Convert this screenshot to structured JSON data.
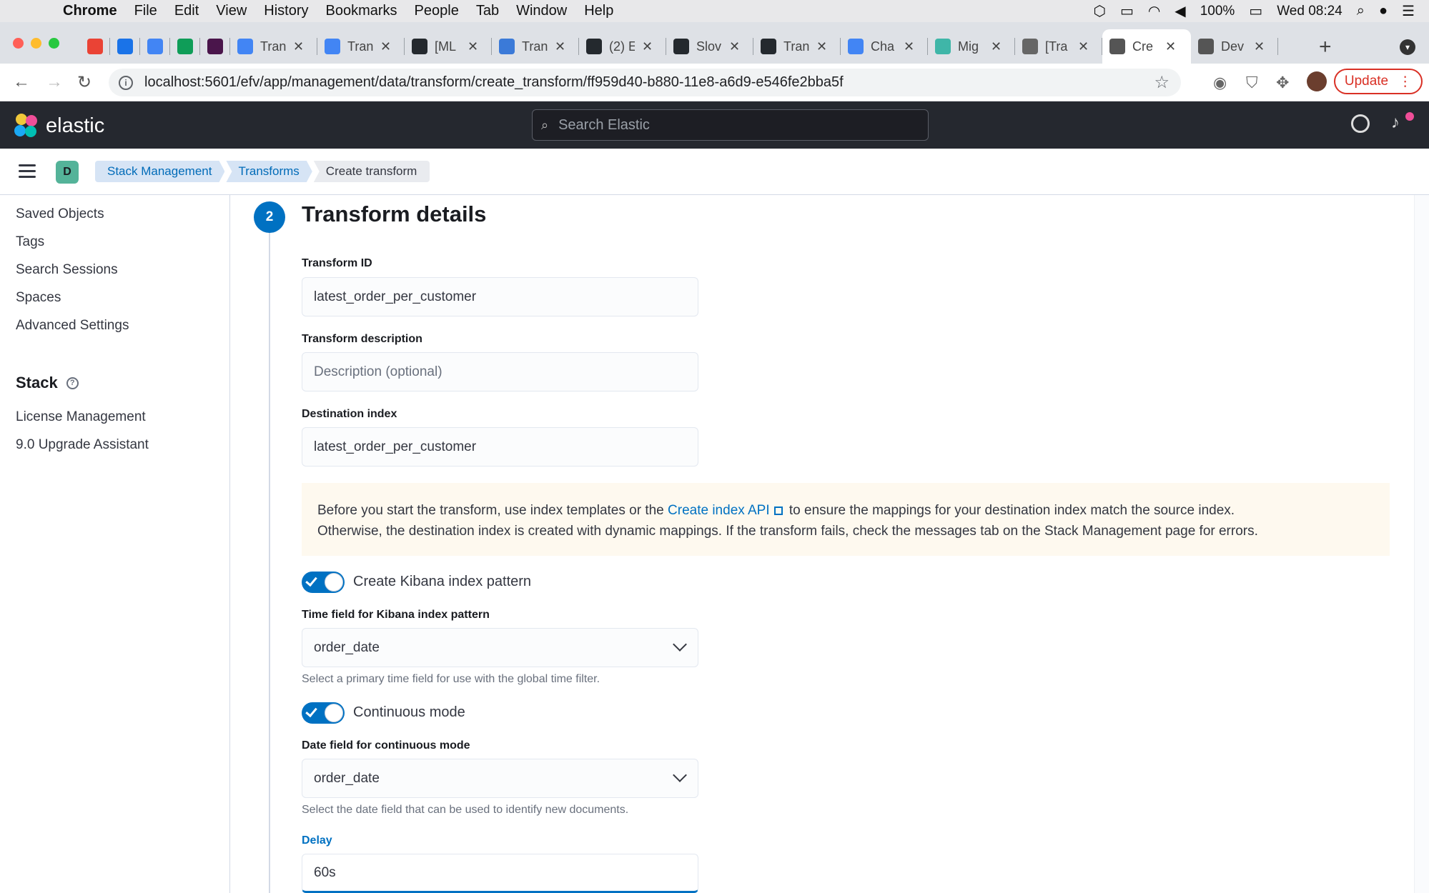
{
  "macos": {
    "app": "Chrome",
    "menus": [
      "File",
      "Edit",
      "View",
      "History",
      "Bookmarks",
      "People",
      "Tab",
      "Window",
      "Help"
    ],
    "battery": "100%",
    "clock": "Wed 08:24"
  },
  "tabs": [
    {
      "title": "",
      "icon": "gmail-icon",
      "color": "#ea4335"
    },
    {
      "title": "",
      "icon": "circle-icon",
      "color": "#1a73e8"
    },
    {
      "title": "",
      "icon": "calendar-icon",
      "color": "#4285f4"
    },
    {
      "title": "",
      "icon": "drive-icon",
      "color": "#0f9d58"
    },
    {
      "title": "",
      "icon": "slack-icon",
      "color": "#4a154b"
    },
    {
      "title": "Tran",
      "icon": "docs-icon",
      "color": "#4285f4"
    },
    {
      "title": "Tran",
      "icon": "docs-icon",
      "color": "#4285f4"
    },
    {
      "title": "[ML",
      "icon": "github-icon",
      "color": "#24292e"
    },
    {
      "title": "Tran",
      "icon": "cog-icon",
      "color": "#3b7ad8"
    },
    {
      "title": "(2) E",
      "icon": "github-icon",
      "color": "#24292e"
    },
    {
      "title": "Slov",
      "icon": "github-icon",
      "color": "#24292e"
    },
    {
      "title": "Tran",
      "icon": "github-icon",
      "color": "#24292e"
    },
    {
      "title": "Cha",
      "icon": "docs-icon",
      "color": "#4285f4"
    },
    {
      "title": "Mig",
      "icon": "app-icon",
      "color": "#3fb6a8"
    },
    {
      "title": "[Tra",
      "icon": "loading-icon",
      "color": "#666666"
    },
    {
      "title": "Cre",
      "icon": "kibana-icon",
      "color": "#555555",
      "active": true
    },
    {
      "title": "Dev",
      "icon": "kibana-icon",
      "color": "#555555"
    }
  ],
  "browser": {
    "url": "localhost:5601/efv/app/management/data/transform/create_transform/ff959d40-b880-11e8-a6d9-e546fe2bba5f",
    "update_label": "Update"
  },
  "kibana": {
    "brand": "elastic",
    "search_placeholder": "Search Elastic",
    "space_initial": "D",
    "breadcrumbs": [
      "Stack Management",
      "Transforms",
      "Create transform"
    ]
  },
  "sidebar": {
    "items_top": [
      "Saved Objects",
      "Tags",
      "Search Sessions",
      "Spaces",
      "Advanced Settings"
    ],
    "section_title": "Stack",
    "items_stack": [
      "License Management",
      "9.0 Upgrade Assistant"
    ]
  },
  "form": {
    "step_number": "2",
    "step_title": "Transform details",
    "transform_id_label": "Transform ID",
    "transform_id_value": "latest_order_per_customer",
    "description_label": "Transform description",
    "description_placeholder": "Description (optional)",
    "dest_index_label": "Destination index",
    "dest_index_value": "latest_order_per_customer",
    "callout_pre": "Before you start the transform, use index templates or the ",
    "callout_link": "Create index API",
    "callout_post": " to ensure the mappings for your destination index match the source index.",
    "callout_line2": "Otherwise, the destination index is created with dynamic mappings. If the transform fails, check the messages tab on the Stack Management page for errors.",
    "create_pattern_label": "Create Kibana index pattern",
    "create_pattern_on": true,
    "time_field_label": "Time field for Kibana index pattern",
    "time_field_value": "order_date",
    "time_field_help": "Select a primary time field for use with the global time filter.",
    "continuous_label": "Continuous mode",
    "continuous_on": true,
    "date_field_label": "Date field for continuous mode",
    "date_field_value": "order_date",
    "date_field_help": "Select the date field that can be used to identify new documents.",
    "delay_label": "Delay",
    "delay_value": "60s"
  }
}
